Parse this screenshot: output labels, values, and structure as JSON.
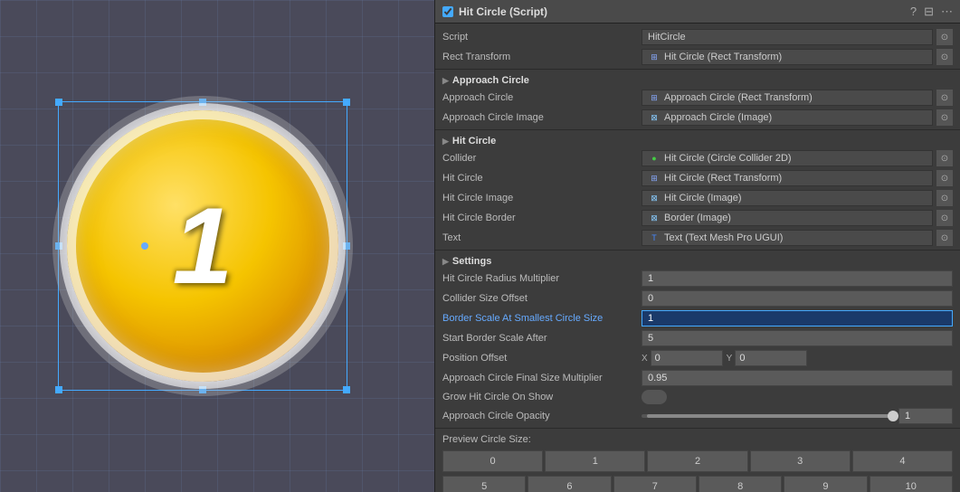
{
  "header": {
    "title": "Hit Circle (Script)",
    "question_icon": "?",
    "layout_icon": "⊟",
    "settings_icon": "⋯"
  },
  "script_row": {
    "label": "Script",
    "value": "HitCircle"
  },
  "rect_transform_row": {
    "label": "Rect Transform",
    "value": "Hit Circle (Rect Transform)"
  },
  "sections": {
    "approach_circle": {
      "title": "Approach Circle",
      "fields": [
        {
          "label": "Approach Circle",
          "value": "Approach Circle (Rect Transform)",
          "icon_type": "transform"
        },
        {
          "label": "Approach Circle Image",
          "value": "Approach Circle (Image)",
          "icon_type": "image"
        }
      ]
    },
    "hit_circle": {
      "title": "Hit Circle",
      "fields": [
        {
          "label": "Collider",
          "value": "Hit Circle (Circle Collider 2D)",
          "icon_type": "circle"
        },
        {
          "label": "Hit Circle",
          "value": "Hit Circle (Rect Transform)",
          "icon_type": "transform"
        },
        {
          "label": "Hit Circle Image",
          "value": "Hit Circle (Image)",
          "icon_type": "image"
        },
        {
          "label": "Hit Circle Border",
          "value": "Border (Image)",
          "icon_type": "image"
        },
        {
          "label": "Text",
          "value": "Text (Text Mesh Pro UGUI)",
          "icon_type": "text"
        }
      ]
    },
    "settings": {
      "title": "Settings",
      "fields": [
        {
          "label": "Hit Circle Radius Multiplier",
          "value": "1",
          "type": "number"
        },
        {
          "label": "Collider Size Offset",
          "value": "0",
          "type": "number"
        },
        {
          "label": "Border Scale At Smallest Circle Size",
          "value": "1",
          "type": "number",
          "highlighted": true
        },
        {
          "label": "Start Border Scale After",
          "value": "5",
          "type": "number"
        },
        {
          "label": "Position Offset",
          "value": null,
          "type": "xy",
          "x": "0",
          "y": "0"
        },
        {
          "label": "Approach Circle Final Size Multiplier",
          "value": "0.95",
          "type": "number"
        },
        {
          "label": "Grow Hit Circle On Show",
          "value": null,
          "type": "toggle"
        },
        {
          "label": "Approach Circle Opacity",
          "value": "1",
          "type": "slider",
          "slider_value": 0.98
        }
      ]
    }
  },
  "preview": {
    "label": "Preview Circle Size:",
    "buttons_row1": [
      "0",
      "1",
      "2",
      "3",
      "4"
    ],
    "buttons_row2": [
      "5",
      "6",
      "7",
      "8",
      "9",
      "10"
    ]
  },
  "circle_number": "1",
  "icons": {
    "transform_icon": "⊞",
    "image_icon": "⊠",
    "circle_icon": "●",
    "text_icon": "T"
  }
}
